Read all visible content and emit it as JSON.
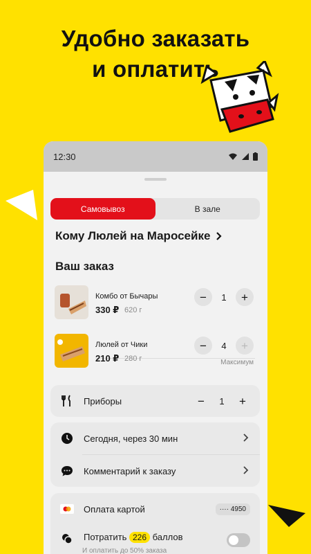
{
  "headline": {
    "line1": "Удобно заказать",
    "line2": "и оплатить"
  },
  "status_bar": {
    "time": "12:30"
  },
  "order_type": {
    "pickup_label": "Самовывоз",
    "dinein_label": "В зале",
    "selected": "pickup"
  },
  "restaurant": {
    "label": "Кому Люлей на Маросейке"
  },
  "order": {
    "title": "Ваш заказ",
    "items": [
      {
        "name": "Комбо от Бычары",
        "price": "330 ₽",
        "weight": "620 г",
        "quantity": "1",
        "note": ""
      },
      {
        "name": "Люлей от Чики",
        "price": "210 ₽",
        "weight": "280 г",
        "quantity": "4",
        "note": "Максимум"
      }
    ]
  },
  "cutlery": {
    "label": "Приборы",
    "quantity": "1"
  },
  "options": {
    "time_label": "Сегодня, через 30 мин",
    "comment_label": "Комментарий к заказу"
  },
  "payment": {
    "method_label": "Оплата картой",
    "card_tail": "···· 4950",
    "spend_prefix": "Потратить",
    "points": "226",
    "spend_suffix": "баллов",
    "spend_subtext": "И оплатить до 50% заказа",
    "spend_enabled": false
  },
  "colors": {
    "background": "#FFE100",
    "accent_red": "#E3101A",
    "card_gray": "#E9E9E9"
  }
}
